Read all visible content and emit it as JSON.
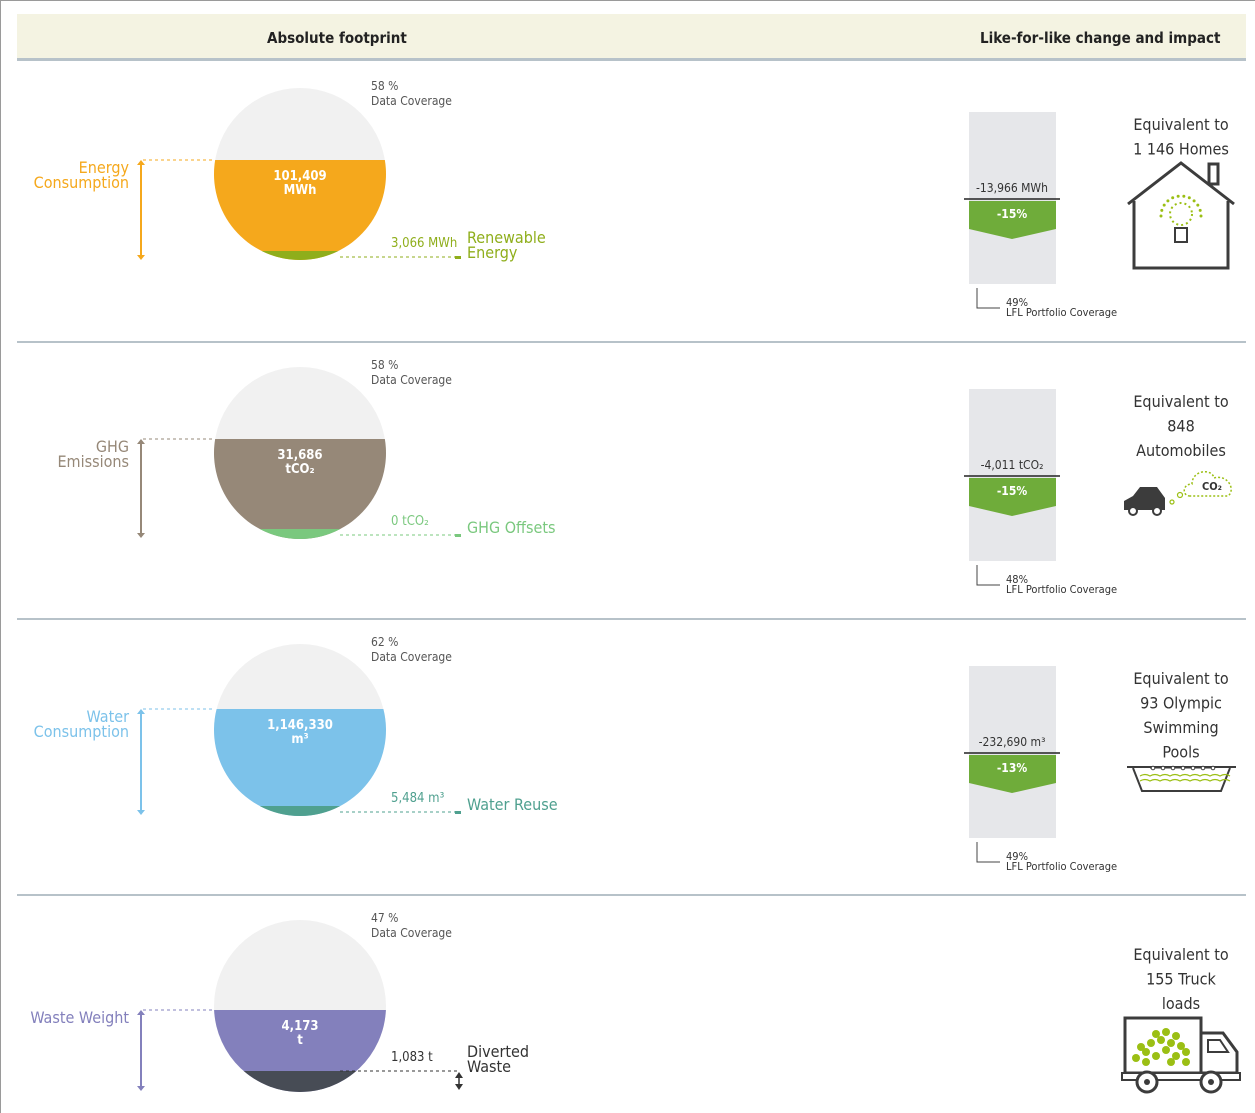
{
  "header": {
    "left_title": "Absolute footprint",
    "right_title": "Like-for-like change and impact"
  },
  "colors": {
    "energy": "#f5a81c",
    "renewable": "#8fae1b",
    "ghg": "#968878",
    "offsets": "#7ac87e",
    "water": "#7cc2ea",
    "reuse": "#4fa08f",
    "waste": "#8380bc",
    "diverted": "#474c55",
    "lfl_bar": "#6fac3a",
    "lfl_bg": "#e6e7ea",
    "icon_green": "#9bbf14",
    "icon_dark": "#3c3c3c"
  },
  "chart_data": [
    {
      "type": "pie",
      "metric": "Energy Consumption",
      "data_coverage_pct": 58,
      "total": 101409,
      "total_unit": "MWh",
      "sub_metric": "Renewable Energy",
      "sub_value": 3066,
      "sub_unit": "MWh",
      "lfl_change": -13966,
      "lfl_unit": "MWh",
      "lfl_pct": -15,
      "lfl_coverage_pct": 49,
      "impact": "Equivalent to 1 146 Homes",
      "impact_icon": "house-bulb-icon"
    },
    {
      "type": "pie",
      "metric": "GHG Emissions",
      "data_coverage_pct": 58,
      "total": 31686,
      "total_unit": "tCO2",
      "sub_metric": "GHG Offsets",
      "sub_value": 0,
      "sub_unit": "tCO2",
      "lfl_change": -4011,
      "lfl_unit": "tCO2",
      "lfl_pct": -15,
      "lfl_coverage_pct": 48,
      "impact": "Equivalent to 848 Automobiles",
      "impact_icon": "car-co2-icon"
    },
    {
      "type": "pie",
      "metric": "Water Consumption",
      "data_coverage_pct": 62,
      "total": 1146330,
      "total_unit": "m3",
      "sub_metric": "Water Reuse",
      "sub_value": 5484,
      "sub_unit": "m3",
      "lfl_change": -232690,
      "lfl_unit": "m3",
      "lfl_pct": -13,
      "lfl_coverage_pct": 49,
      "impact": "Equivalent to 93 Olympic Swimming Pools",
      "impact_icon": "swimming-pool-icon"
    },
    {
      "type": "pie",
      "metric": "Waste Weight",
      "data_coverage_pct": 47,
      "total": 4173,
      "total_unit": "t",
      "sub_metric": "Diverted Waste",
      "sub_value": 1083,
      "sub_unit": "t",
      "impact": "Equivalent to 155 Truck loads",
      "impact_icon": "truck-icon"
    }
  ],
  "rows": [
    {
      "key": "energy",
      "cov_pct": "58 %",
      "cov_label": "Data Coverage",
      "label_lines": [
        "Energy",
        "Consumption"
      ],
      "value_lines": [
        "101,409",
        "MWh"
      ],
      "sub_value_text": "3,066 MWh",
      "sub_label_lines": [
        "Renewable",
        "Energy"
      ],
      "lfl": {
        "change_text": "-13,966 MWh",
        "pct_text": "-15%",
        "cov_pct": "49%",
        "cov_label": "LFL Portfolio Coverage"
      },
      "impact_lines": [
        "Equivalent to",
        "1 146 Homes"
      ]
    },
    {
      "key": "ghg",
      "cov_pct": "58 %",
      "cov_label": "Data Coverage",
      "label_lines": [
        "GHG",
        "Emissions"
      ],
      "value_lines": [
        "31,686",
        "tCO₂"
      ],
      "sub_value_text": "0 tCO₂",
      "sub_label_lines": [
        "GHG Offsets"
      ],
      "lfl": {
        "change_text": "-4,011 tCO₂",
        "pct_text": "-15%",
        "cov_pct": "48%",
        "cov_label": "LFL Portfolio Coverage"
      },
      "impact_lines": [
        "Equivalent to",
        "848",
        "Automobiles"
      ],
      "icon_text": "CO₂"
    },
    {
      "key": "water",
      "cov_pct": "62 %",
      "cov_label": "Data Coverage",
      "label_lines": [
        "Water",
        "Consumption"
      ],
      "value_lines": [
        "1,146,330",
        "m³"
      ],
      "sub_value_text": "5,484 m³",
      "sub_label_lines": [
        "Water Reuse"
      ],
      "lfl": {
        "change_text": "-232,690 m³",
        "pct_text": "-13%",
        "cov_pct": "49%",
        "cov_label": "LFL Portfolio Coverage"
      },
      "impact_lines": [
        "Equivalent to",
        "93 Olympic",
        "Swimming",
        "Pools"
      ]
    },
    {
      "key": "waste",
      "cov_pct": "47 %",
      "cov_label": "Data Coverage",
      "label_lines": [
        "Waste Weight"
      ],
      "value_lines": [
        "4,173",
        "t"
      ],
      "sub_value_text": "1,083 t",
      "sub_label_lines": [
        "Diverted",
        "Waste"
      ],
      "impact_lines": [
        "Equivalent to",
        "155 Truck",
        "loads"
      ]
    }
  ]
}
